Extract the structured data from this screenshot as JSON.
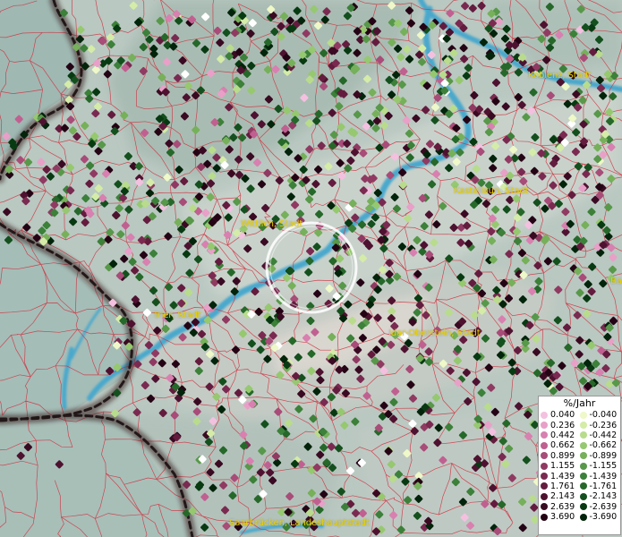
{
  "map": {
    "cities": [
      {
        "id": "koblenz",
        "label": "Koblenz, Stadt"
      },
      {
        "id": "kastellaun",
        "label": "Kastellaun, Stadt"
      },
      {
        "id": "wittlich",
        "label": "Wittlich, Stadt"
      },
      {
        "id": "trier",
        "label": "Trier, Stadt"
      },
      {
        "id": "idar-oberstein",
        "label": "Idar-Oberstein, Stadt"
      },
      {
        "id": "saarbruecken",
        "label": "Saarbrücken, Landeshauptstadt"
      },
      {
        "id": "ba-partial",
        "label": "Ba"
      }
    ],
    "selection_circle": true
  },
  "legend": {
    "title": "%/Jahr",
    "positive": [
      {
        "value": "0.040",
        "color": "#f4c0e0"
      },
      {
        "value": "0.236",
        "color": "#e8a0c8"
      },
      {
        "value": "0.442",
        "color": "#d880b0"
      },
      {
        "value": "0.662",
        "color": "#c06090"
      },
      {
        "value": "0.899",
        "color": "#a84c78"
      },
      {
        "value": "1.155",
        "color": "#903a62"
      },
      {
        "value": "1.439",
        "color": "#7a2a50"
      },
      {
        "value": "1.761",
        "color": "#641c3e"
      },
      {
        "value": "2.143",
        "color": "#4e1230"
      },
      {
        "value": "2.639",
        "color": "#3a0a22"
      },
      {
        "value": "3.690",
        "color": "#240414"
      }
    ],
    "negative": [
      {
        "value": "-0.040",
        "color": "#eef8c8"
      },
      {
        "value": "-0.236",
        "color": "#d4eca8"
      },
      {
        "value": "-0.442",
        "color": "#b8dc8c"
      },
      {
        "value": "-0.662",
        "color": "#96c870"
      },
      {
        "value": "-0.899",
        "color": "#76b05a"
      },
      {
        "value": "-1.155",
        "color": "#58984a"
      },
      {
        "value": "-1.439",
        "color": "#3c803a"
      },
      {
        "value": "-1.761",
        "color": "#26682a"
      },
      {
        "value": "-2.143",
        "color": "#14501e"
      },
      {
        "value": "-2.639",
        "color": "#083a12"
      },
      {
        "value": "-3.690",
        "color": "#02240a"
      }
    ]
  }
}
